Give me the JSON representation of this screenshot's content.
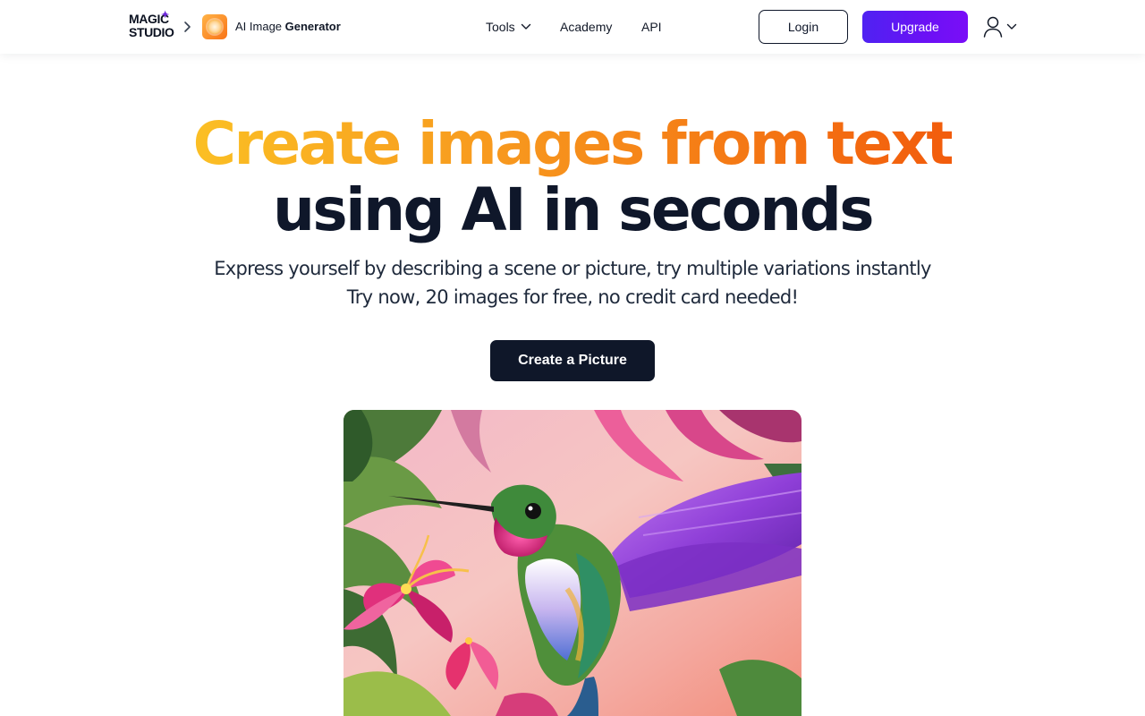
{
  "header": {
    "logo_line1": "MAGIC",
    "logo_line2": "STUDIO",
    "breadcrumb_separator": ">",
    "app_name_light": "AI Image ",
    "app_name_bold": "Generator",
    "nav": {
      "tools": "Tools",
      "academy": "Academy",
      "api": "API"
    },
    "login_label": "Login",
    "upgrade_label": "Upgrade",
    "user_icon": "user-icon"
  },
  "hero": {
    "headline_accent": "Create images from text",
    "headline_rest": "using AI in seconds",
    "subtitle_line1": "Express yourself by describing a scene or picture, try multiple variations instantly",
    "subtitle_line2": "Try now, 20 images for free, no credit card needed!",
    "cta_label": "Create a Picture"
  },
  "colors": {
    "accent_gradient_start": "#fbbf24",
    "accent_gradient_end": "#f25c0c",
    "upgrade_gradient_start": "#4f22f2",
    "upgrade_gradient_end": "#7a0ef7",
    "cta_background": "#0f1729",
    "text_dark": "#0f172a"
  }
}
